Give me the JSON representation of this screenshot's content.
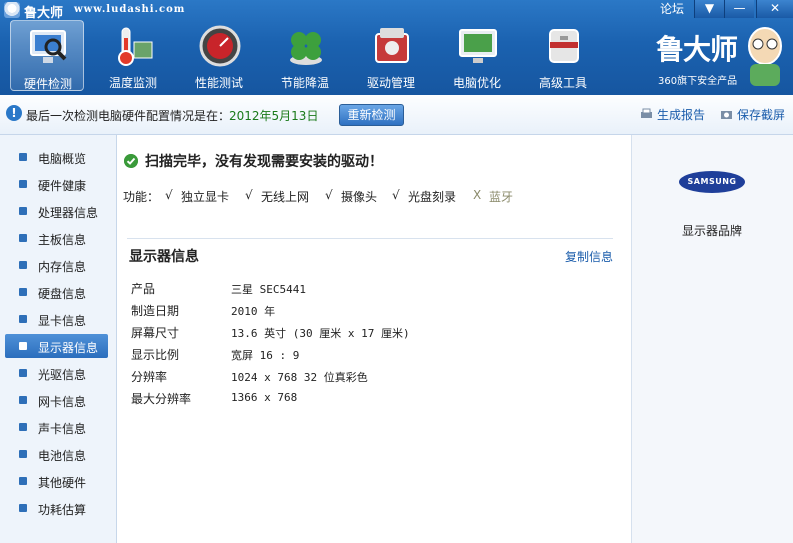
{
  "app": {
    "title": "鲁大师",
    "url": "www.ludashi.com",
    "forum": "论坛"
  },
  "window": {
    "menu": "▼",
    "minimize": "—",
    "close": "✕"
  },
  "toolbar": {
    "items": [
      {
        "label": "硬件检测",
        "icon": "monitor-magnifier-icon"
      },
      {
        "label": "温度监测",
        "icon": "thermometer-icon"
      },
      {
        "label": "性能测试",
        "icon": "speedometer-icon"
      },
      {
        "label": "节能降温",
        "icon": "clover-icon"
      },
      {
        "label": "驱动管理",
        "icon": "driver-box-icon"
      },
      {
        "label": "电脑优化",
        "icon": "screen-optimize-icon"
      },
      {
        "label": "高级工具",
        "icon": "toolbox-icon"
      }
    ]
  },
  "brand": {
    "name": "鲁大师",
    "sub": "360旗下安全产品"
  },
  "status": {
    "label": "最后一次检测电脑硬件配置情况是在：",
    "date": "2012年5月13日",
    "recheck": "重新检测",
    "report": "生成报告",
    "screenshot": "保存截屏"
  },
  "sidebar": {
    "items": [
      {
        "label": "电脑概览"
      },
      {
        "label": "硬件健康"
      },
      {
        "label": "处理器信息"
      },
      {
        "label": "主板信息"
      },
      {
        "label": "内存信息"
      },
      {
        "label": "硬盘信息"
      },
      {
        "label": "显卡信息"
      },
      {
        "label": "显示器信息"
      },
      {
        "label": "光驱信息"
      },
      {
        "label": "网卡信息"
      },
      {
        "label": "声卡信息"
      },
      {
        "label": "电池信息"
      },
      {
        "label": "其他硬件"
      },
      {
        "label": "功耗估算"
      }
    ],
    "active_index": 7
  },
  "main": {
    "scan_message": "扫描完毕，没有发现需要安装的驱动！",
    "features_label": "功能：",
    "features": [
      {
        "mark": "√",
        "name": "独立显卡"
      },
      {
        "mark": "√",
        "name": "无线上网"
      },
      {
        "mark": "√",
        "name": "摄像头"
      },
      {
        "mark": "√",
        "name": "光盘刻录"
      },
      {
        "mark": "X",
        "name": "蓝牙"
      }
    ],
    "section_title": "显示器信息",
    "copy_link": "复制信息",
    "rows": [
      {
        "label": "产品",
        "value": "三星 SEC5441"
      },
      {
        "label": "制造日期",
        "value": "2010 年"
      },
      {
        "label": "屏幕尺寸",
        "value": "13.6 英寸 (30 厘米 x 17 厘米)"
      },
      {
        "label": "显示比例",
        "value": "宽屏 16 : 9"
      },
      {
        "label": "分辨率",
        "value": "1024 x 768 32 位真彩色"
      },
      {
        "label": "最大分辨率",
        "value": "1366 x 768"
      }
    ]
  },
  "right_panel": {
    "logo_text": "SAMSUNG",
    "caption": "显示器品牌"
  },
  "colors": {
    "accent": "#1b62b0",
    "link": "#1a5cab",
    "date": "#1a7a1a",
    "ok": "#3a9a3a"
  }
}
